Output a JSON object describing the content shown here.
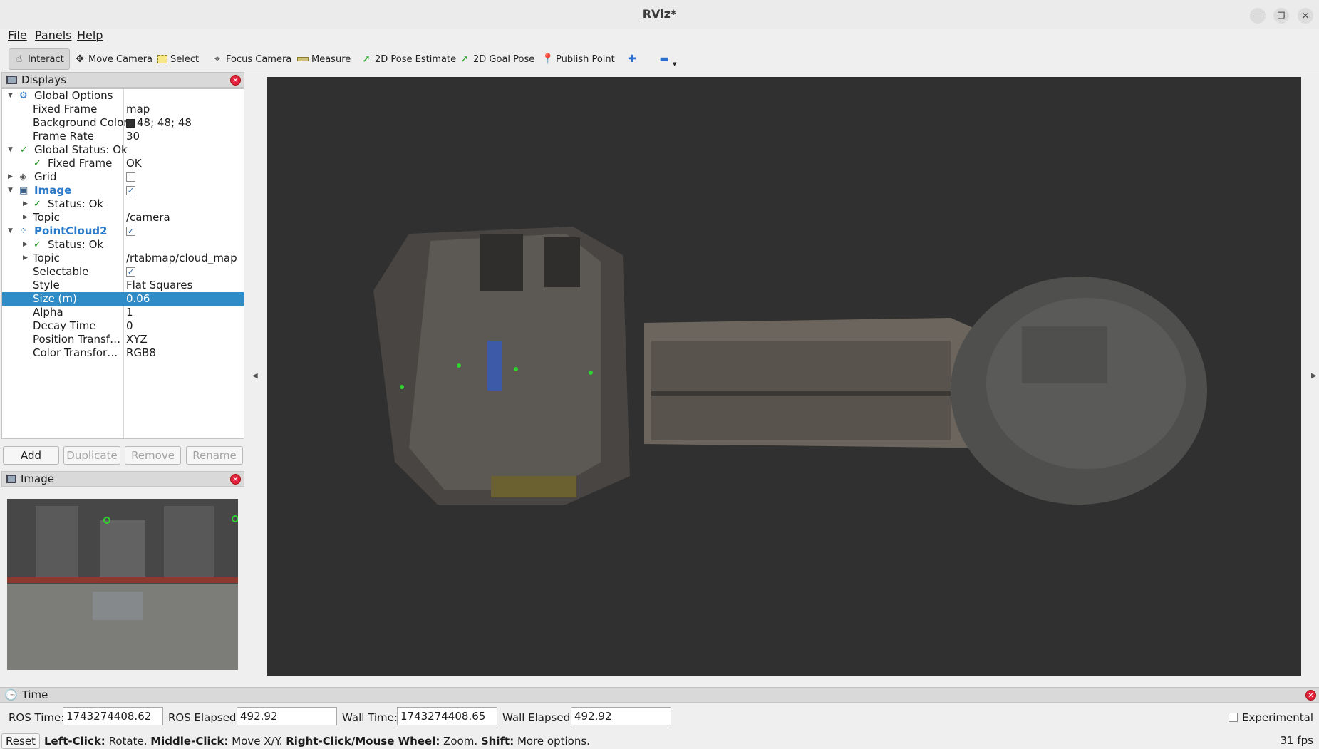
{
  "window": {
    "title": "RViz*"
  },
  "menu": {
    "file": "File",
    "panels": "Panels",
    "help": "Help"
  },
  "toolbar": {
    "interact": "Interact",
    "move_camera": "Move Camera",
    "select": "Select",
    "focus_camera": "Focus Camera",
    "measure": "Measure",
    "pose_estimate": "2D Pose Estimate",
    "goal_pose": "2D Goal Pose",
    "publish_point": "Publish Point"
  },
  "displays": {
    "title": "Displays",
    "rows": [
      {
        "name": "Global Options",
        "value": ""
      },
      {
        "name": "Fixed Frame",
        "value": "map"
      },
      {
        "name": "Background Color",
        "value": "48; 48; 48"
      },
      {
        "name": "Frame Rate",
        "value": "30"
      },
      {
        "name": "Global Status: Ok",
        "value": ""
      },
      {
        "name": "Fixed Frame",
        "value": "OK"
      },
      {
        "name": "Grid",
        "value": ""
      },
      {
        "name": "Image",
        "value": ""
      },
      {
        "name": "Status: Ok",
        "value": ""
      },
      {
        "name": "Topic",
        "value": "/camera"
      },
      {
        "name": "PointCloud2",
        "value": ""
      },
      {
        "name": "Status: Ok",
        "value": ""
      },
      {
        "name": "Topic",
        "value": "/rtabmap/cloud_map"
      },
      {
        "name": "Selectable",
        "value": ""
      },
      {
        "name": "Style",
        "value": "Flat Squares"
      },
      {
        "name": "Size (m)",
        "value": "0.06"
      },
      {
        "name": "Alpha",
        "value": "1"
      },
      {
        "name": "Decay Time",
        "value": "0"
      },
      {
        "name": "Position Transf…",
        "value": "XYZ"
      },
      {
        "name": "Color Transfor…",
        "value": "RGB8"
      }
    ],
    "buttons": {
      "add": "Add",
      "duplicate": "Duplicate",
      "remove": "Remove",
      "rename": "Rename"
    }
  },
  "image_panel": {
    "title": "Image"
  },
  "time": {
    "title": "Time",
    "ros_time_label": "ROS Time:",
    "ros_time": "1743274408.62",
    "ros_elapsed_label": "ROS Elapsed:",
    "ros_elapsed": "492.92",
    "wall_time_label": "Wall Time:",
    "wall_time": "1743274408.65",
    "wall_elapsed_label": "Wall Elapsed:",
    "wall_elapsed": "492.92",
    "experimental": "Experimental"
  },
  "status": {
    "reset": "Reset",
    "left_click": "Left-Click:",
    "left_click_desc": " Rotate. ",
    "middle_click": "Middle-Click:",
    "middle_click_desc": " Move X/Y. ",
    "right_click": "Right-Click/Mouse Wheel:",
    "right_click_desc": " Zoom. ",
    "shift": "Shift:",
    "shift_desc": " More options.",
    "fps": "31 fps"
  },
  "colors": {
    "background": "#303030",
    "selection": "#308cc6",
    "accent": "#2a7ac9"
  }
}
